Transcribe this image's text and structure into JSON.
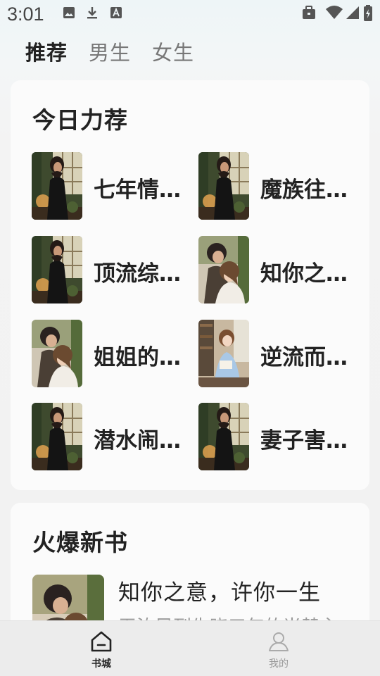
{
  "status_bar": {
    "time": "3:01",
    "left_icons": [
      "image-icon",
      "download-icon",
      "font-icon"
    ],
    "right_icons": [
      "briefcase-icon",
      "wifi-icon",
      "signal-icon",
      "battery-icon"
    ]
  },
  "top_tabs": [
    {
      "label": "推荐",
      "active": true
    },
    {
      "label": "男生",
      "active": false
    },
    {
      "label": "女生",
      "active": false
    }
  ],
  "recommend": {
    "title": "今日力荐",
    "books": [
      {
        "title": "七年情...",
        "cover": "cover-woman-window"
      },
      {
        "title": "魔族往...",
        "cover": "cover-woman-window"
      },
      {
        "title": "顶流综...",
        "cover": "cover-woman-window"
      },
      {
        "title": "知你之...",
        "cover": "cover-couple"
      },
      {
        "title": "姐姐的...",
        "cover": "cover-couple"
      },
      {
        "title": "逆流而...",
        "cover": "cover-girl-reading"
      },
      {
        "title": "潜水闹...",
        "cover": "cover-woman-window"
      },
      {
        "title": "妻子害...",
        "cover": "cover-woman-window"
      }
    ]
  },
  "hot_new": {
    "title": "火爆新书",
    "book_title": "知你之意，许你一生",
    "book_desc": "无汝风到先晓三年的当替主"
  },
  "bottom_nav": [
    {
      "label": "书城",
      "icon": "home-icon",
      "active": true
    },
    {
      "label": "我的",
      "icon": "person-icon",
      "active": false
    }
  ],
  "colors": {
    "background": "#f2f2f2",
    "card": "#fbfbfb",
    "text_primary": "#222222",
    "text_secondary": "#999999",
    "nav_bg": "#ececec"
  }
}
